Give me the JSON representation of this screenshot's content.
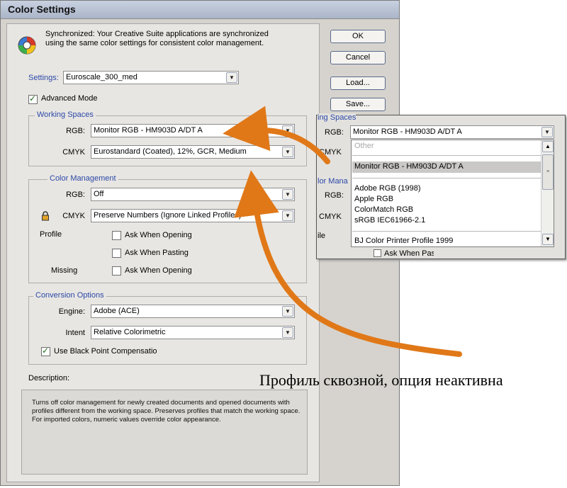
{
  "window": {
    "title": "Color Settings"
  },
  "sync_message": "Synchronized: Your Creative Suite applications are synchronized using the same color settings for consistent color management.",
  "buttons": {
    "ok": "OK",
    "cancel": "Cancel",
    "load": "Load...",
    "save": "Save..."
  },
  "settings": {
    "label": "Settings:",
    "value": "Euroscale_300_med",
    "advanced_mode": "Advanced Mode"
  },
  "working_spaces": {
    "title": "Working Spaces",
    "rgb_label": "RGB:",
    "rgb_value": "Monitor RGB - HM903D A/DT A",
    "cmyk_label": "CMYK",
    "cmyk_value": "Eurostandard (Coated), 12%, GCR, Medium"
  },
  "color_management": {
    "title": "Color Management",
    "rgb_label": "RGB:",
    "rgb_value": "Off",
    "cmyk_label": "CMYK",
    "cmyk_value": "Preserve Numbers (Ignore Linked Profiles)",
    "profile_label": "Profile",
    "missing_label": "Missing",
    "ask_opening_1": "Ask When Opening",
    "ask_pasting": "Ask When Pasting",
    "ask_opening_2": "Ask When Opening"
  },
  "conversion": {
    "title": "Conversion Options",
    "engine_label": "Engine:",
    "engine_value": "Adobe (ACE)",
    "intent_label": "Intent",
    "intent_value": "Relative Colorimetric",
    "bpc": "Use Black Point Compensation"
  },
  "description": {
    "label": "Description:",
    "text": "Turns off color management for newly created documents and opened documents with profiles different from the working space. Preserves profiles that match the working space. For imported colors, numeric values override color appearance."
  },
  "popup": {
    "partial_title": "ing Spaces",
    "rgb_label": "RGB:",
    "rgb_value": "Monitor RGB - HM903D A/DT A",
    "cmyk_label": "CMYK",
    "cm_partial": "lor Mana",
    "rgb2_label": "RGB:",
    "cmyk2_label": "CMYK",
    "file_partial": "ile",
    "ask_pasting_partial": "Ask When Pasting",
    "list": {
      "other": "Other",
      "selected": "Monitor RGB - HM903D A/DT A",
      "group": [
        "Adobe RGB (1998)",
        "Apple RGB",
        "ColorMatch RGB",
        "sRGB IEC61966-2.1"
      ],
      "last": "BJ Color Printer Profile 1999"
    }
  },
  "annotation": "Профиль сквозной, опция неактивна",
  "colors": {
    "arrow": "#e07818",
    "legend": "#2b48a8",
    "dialog_bg": "#d6d3ce"
  },
  "icons": [
    "color-wheel-icon",
    "lock-icon",
    "dropdown-arrow-icon",
    "checkmark-icon"
  ]
}
